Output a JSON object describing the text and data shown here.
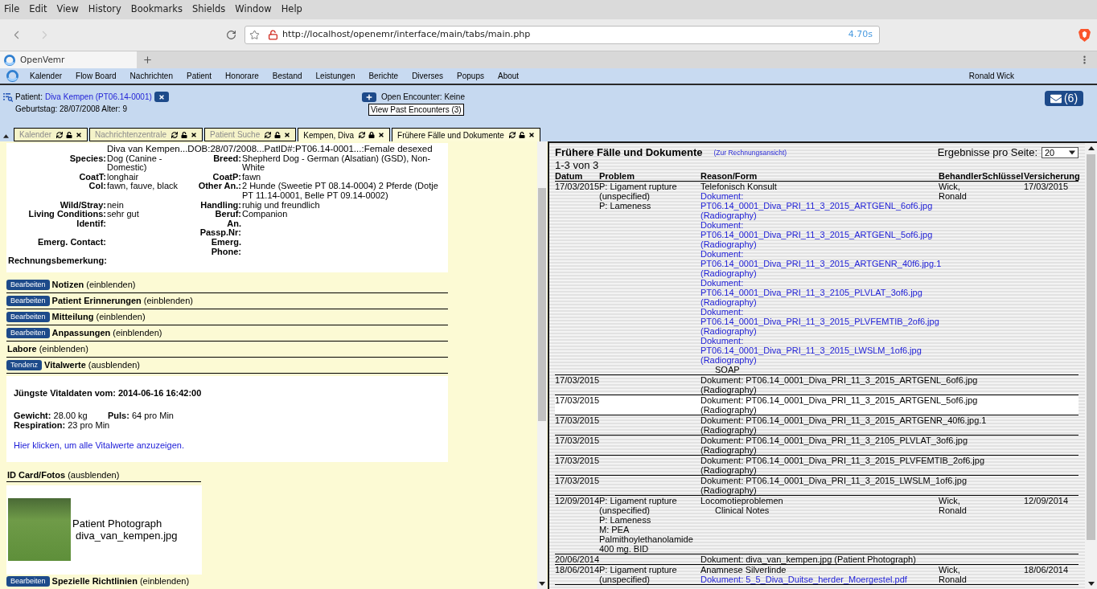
{
  "browser": {
    "menu": [
      "File",
      "Edit",
      "View",
      "History",
      "Bookmarks",
      "Shields",
      "Window",
      "Help"
    ],
    "url": "http://localhost/openemr/interface/main/tabs/main.php",
    "load_time": "4.70s",
    "tab_title": "OpenVemr"
  },
  "nav": {
    "items": [
      "Kalender",
      "Flow Board",
      "Nachrichten",
      "Patient",
      "Honorare",
      "Bestand",
      "Leistungen",
      "Berichte",
      "Diverses",
      "Popups",
      "About"
    ],
    "user": "Ronald Wick"
  },
  "patient": {
    "label": "Patient:",
    "name": "Diva Kempen (PT06.14-0001)",
    "birth": "Geburtstag: 28/07/2008 Alter: 9",
    "encounter": "Open Encounter: Keine",
    "past_encounters": "View Past Encounters (3)",
    "messages": "(6)"
  },
  "tabs": [
    {
      "label": "Kalender",
      "selected": false,
      "locked": false
    },
    {
      "label": "Nachrichtenzentrale",
      "selected": false,
      "locked": false
    },
    {
      "label": "Patient Suche",
      "selected": false,
      "locked": false
    },
    {
      "label": "Kempen, Diva",
      "selected": true,
      "locked": true
    },
    {
      "label": "Frühere Fälle und Dokumente",
      "selected": true,
      "locked": false
    }
  ],
  "demographics": {
    "summary": "Diva van Kempen...DOB:28/07/2008...PatID#:PT06.14-0001...:Female desexed",
    "rows": [
      [
        {
          "label": "Species:",
          "value": "Dog (Canine - Domestic)"
        },
        {
          "label": "Breed:",
          "value": "Shepherd Dog - German (Alsatian) (GSD), Non-White"
        }
      ],
      [
        {
          "label": "CoatT:",
          "value": "longhair"
        },
        {
          "label": "CoatP:",
          "value": "fawn"
        }
      ],
      [
        {
          "label": "Col:",
          "value": "fawn, fauve, black"
        },
        {
          "label": "Other An.:",
          "value": "2 Hunde (Sweetie PT 08.14-0004) 2 Pferde (Dotje PT 11.14-0001, Belle PT 09.14-0002)"
        }
      ],
      [
        {
          "label": "Wild/Stray:",
          "value": "nein"
        },
        {
          "label": "Handling:",
          "value": "ruhig und freundlich"
        }
      ],
      [
        {
          "label": "Living Conditions:",
          "value": "sehr gut"
        },
        {
          "label": "Beruf:",
          "value": "Companion"
        }
      ],
      [
        {
          "label": "Identif:"
        },
        {
          "label": "An. Passp.Nr:"
        }
      ],
      [
        {
          "label": "Emerg. Contact:"
        },
        {
          "label": "Emerg. Phone:"
        }
      ],
      [
        {
          "label": "Rechnungsbemerkung:"
        }
      ]
    ]
  },
  "sections": [
    {
      "button": "Bearbeiten",
      "title": "Notizen",
      "toggle": "(einblenden)"
    },
    {
      "button": "Bearbeiten",
      "title": "Patient Erinnerungen",
      "toggle": "(einblenden)"
    },
    {
      "button": "Bearbeiten",
      "title": "Mitteilung",
      "toggle": "(einblenden)"
    },
    {
      "button": "Bearbeiten",
      "title": "Anpassungen",
      "toggle": "(einblenden)"
    },
    {
      "title": "Labore",
      "toggle": "(einblenden)"
    },
    {
      "button": "Tendenz",
      "title": "Vitalwerte",
      "toggle": "(ausblenden)"
    }
  ],
  "vitals": {
    "heading": "Jüngste Vitaldaten vom: 2014-06-16 16:42:00",
    "items": [
      {
        "label": "Gewicht:",
        "value": "28.00 kg"
      },
      {
        "label": "Puls:",
        "value": "64 pro Min"
      },
      {
        "label": "Respiration:",
        "value": "23 pro Min"
      }
    ],
    "link": "Hier klicken, um alle Vitalwerte anzuzeigen."
  },
  "id_card": {
    "title": "ID Card/Fotos",
    "toggle": "(ausblenden)",
    "caption": "Patient Photograph",
    "file": "diva_van_kempen.jpg"
  },
  "more_sections": [
    {
      "button": "Bearbeiten",
      "title": "Spezielle Richtlinien",
      "toggle": "(einblenden)"
    }
  ],
  "encounters": {
    "title": "Frühere Fälle und Dokumente",
    "billing_link": "(Zur Rechnungsansicht)",
    "per_page_label": "Ergebnisse pro Seite:",
    "per_page": "20",
    "count": "1-3 von 3",
    "columns": [
      "Datum",
      "Problem",
      "Reason/Form",
      "Behandler",
      "Schlüssel",
      "Versicherung"
    ],
    "rows": [
      {
        "kind": "encounter",
        "highlighted": false,
        "date": "17/03/2015",
        "problems": [
          "P: Ligament rupture (unspecified)",
          "P: Lameness"
        ],
        "reason": "Telefonisch Konsult",
        "documents": [
          {
            "name": "Dokument: PT06.14_0001_Diva_PRI_11_3_2015_ARTGENL_6of6.jpg",
            "category": "(Radiography)"
          },
          {
            "name": "Dokument: PT06.14_0001_Diva_PRI_11_3_2015_ARTGENL_5of6.jpg",
            "category": "(Radiography)"
          },
          {
            "name": "Dokument: PT06.14_0001_Diva_PRI_11_3_2015_ARTGENR_40f6.jpg.1",
            "category": "(Radiography)"
          },
          {
            "name": "Dokument: PT06.14_0001_Diva_PRI_11_3_2105_PLVLAT_3of6.jpg",
            "category": "(Radiography)"
          },
          {
            "name": "Dokument: PT06.14_0001_Diva_PRI_11_3_2015_PLVFEMTIB_2of6.jpg",
            "category": "(Radiography)"
          },
          {
            "name": "Dokument: PT06.14_0001_Diva_PRI_11_3_2015_LWSLM_1of6.jpg",
            "category": "(Radiography)"
          }
        ],
        "forms": [
          "SOAP"
        ],
        "provider": "Wick, Ronald",
        "versicherung": "17/03/2015"
      },
      {
        "kind": "document",
        "highlighted": false,
        "date": "17/03/2015",
        "document": "Dokument: PT06.14_0001_Diva_PRI_11_3_2015_ARTGENL_6of6.jpg",
        "category": "(Radiography)"
      },
      {
        "kind": "document",
        "highlighted": true,
        "date": "17/03/2015",
        "document": "Dokument: PT06.14_0001_Diva_PRI_11_3_2015_ARTGENL_5of6.jpg",
        "category": "(Radiography)"
      },
      {
        "kind": "document",
        "highlighted": false,
        "date": "17/03/2015",
        "document": "Dokument: PT06.14_0001_Diva_PRI_11_3_2015_ARTGENR_40f6.jpg.1",
        "category": "(Radiography)"
      },
      {
        "kind": "document",
        "highlighted": false,
        "date": "17/03/2015",
        "document": "Dokument: PT06.14_0001_Diva_PRI_11_3_2105_PLVLAT_3of6.jpg",
        "category": "(Radiography)"
      },
      {
        "kind": "document",
        "highlighted": false,
        "date": "17/03/2015",
        "document": "Dokument: PT06.14_0001_Diva_PRI_11_3_2015_PLVFEMTIB_2of6.jpg",
        "category": "(Radiography)"
      },
      {
        "kind": "document",
        "highlighted": false,
        "date": "17/03/2015",
        "document": "Dokument: PT06.14_0001_Diva_PRI_11_3_2015_LWSLM_1of6.jpg",
        "category": "(Radiography)"
      },
      {
        "kind": "encounter",
        "highlighted": false,
        "date": "12/09/2014",
        "problems": [
          "P: Ligament rupture (unspecified)",
          "P: Lameness",
          "M: PEA Palmithoylethanolamide 400 mg. BID"
        ],
        "reason": "Locomotieproblemen",
        "forms": [
          "Clinical Notes"
        ],
        "provider": "Wick, Ronald",
        "versicherung": "12/09/2014"
      },
      {
        "kind": "document",
        "highlighted": false,
        "date": "20/06/2014",
        "document": "Dokument: diva_van_kempen.jpg (Patient Photograph)"
      },
      {
        "kind": "encounter",
        "highlighted": false,
        "date": "18/06/2014",
        "problems": [
          "P: Ligament rupture (unspecified)"
        ],
        "reason": "Anamnese Silverlinde",
        "documents": [
          {
            "name": "Dokument: 5_5_Diva_Duitse_herder_Moergestel.pdf"
          }
        ],
        "provider": "Wick, Ronald",
        "versicherung": "18/06/2014"
      }
    ]
  }
}
